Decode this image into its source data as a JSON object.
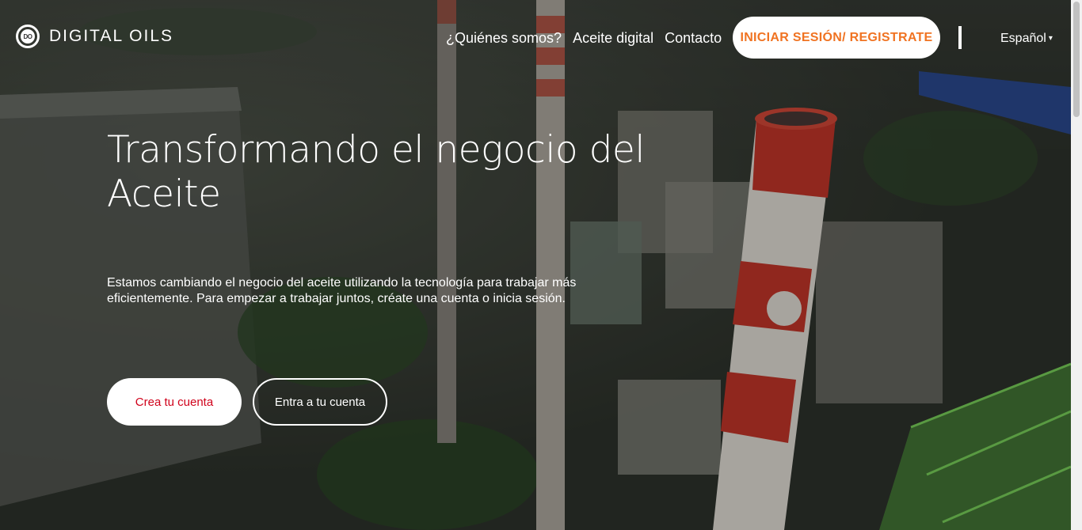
{
  "brand": {
    "logo_mark": "DO",
    "name": "DIGITAL OILS"
  },
  "nav": {
    "links": [
      "¿Quiénes somos?",
      "Aceite digital",
      "Contacto"
    ],
    "login_label": "INICIAR SESIÓN/ REGISTRATE",
    "language": "Español"
  },
  "hero": {
    "title": "Transformando el negocio del Aceite",
    "description": "Estamos cambiando el negocio del aceite utilizando la tecnología para trabajar más eficientemente. Para empezar a trabajar juntos, créate una cuenta o inicia sesión.",
    "primary_button": "Crea tu cuenta",
    "secondary_button": "Entra a tu cuenta"
  },
  "colors": {
    "accent_orange": "#f07322",
    "accent_red": "#d0021b",
    "white": "#ffffff"
  },
  "icons": {
    "language_caret": "caret-down-icon",
    "logo": "digital-oils-logo-icon"
  }
}
